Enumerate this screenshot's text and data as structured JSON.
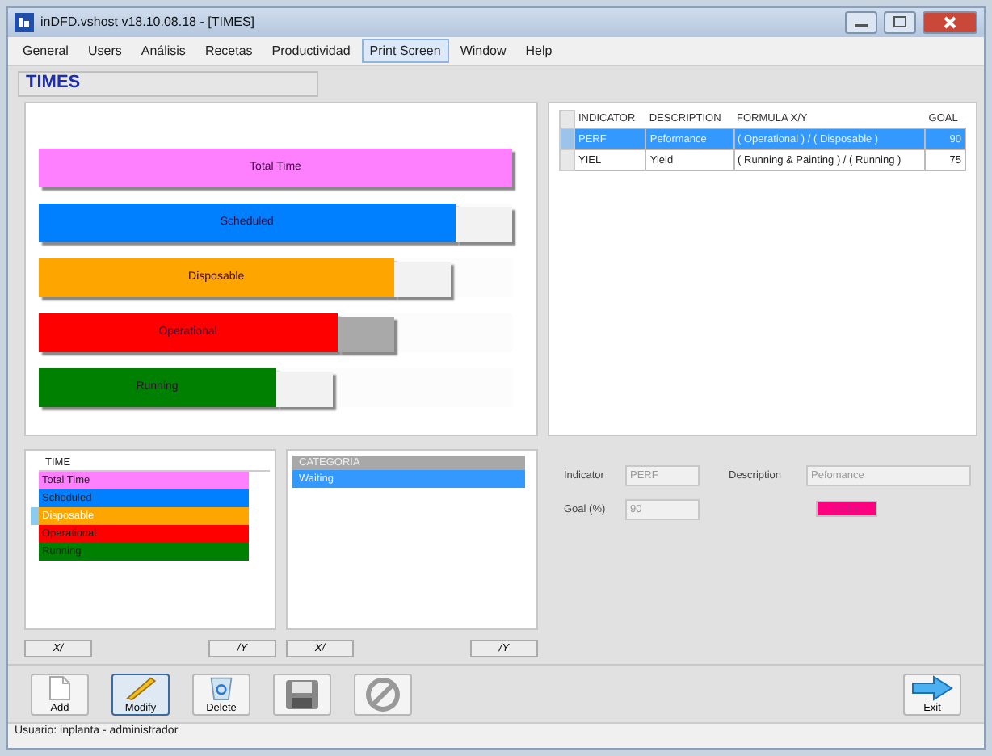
{
  "window": {
    "title": "inDFD.vshost v18.10.08.18 - [TIMES]"
  },
  "menu": [
    {
      "label": "General",
      "selected": false
    },
    {
      "label": "Users",
      "selected": false
    },
    {
      "label": "Análisis",
      "selected": false
    },
    {
      "label": "Recetas",
      "selected": false
    },
    {
      "label": "Productividad",
      "selected": false
    },
    {
      "label": "Print Screen",
      "selected": true
    },
    {
      "label": "Window",
      "selected": false
    },
    {
      "label": "Help",
      "selected": false
    }
  ],
  "header": {
    "title": "TIMES"
  },
  "bars": [
    {
      "label": "Total Time",
      "color": "#ff80ff",
      "level": 1.0
    },
    {
      "label": "Scheduled",
      "color": "#0080ff",
      "level": 0.88,
      "cap": {
        "color": "#f2f2f2"
      }
    },
    {
      "label": "Disposable",
      "color": "#ffa500",
      "level": 0.75,
      "cap": {
        "color": "#f2f2f2"
      }
    },
    {
      "label": "Operational",
      "color": "#ff0000",
      "level": 0.63,
      "cap": {
        "color": "#a9a9a9"
      }
    },
    {
      "label": "Running",
      "color": "#008000",
      "level": 0.5,
      "cap": {
        "color": "#f2f2f2"
      }
    }
  ],
  "indicators": {
    "columns": [
      "INDICATOR",
      "DESCRIPTION",
      "FORMULA X/Y",
      "GOAL"
    ],
    "rows": [
      {
        "cells": [
          "PERF",
          "Peformance",
          "( Operational ) / ( Disposable )",
          "90"
        ],
        "selected": true
      },
      {
        "cells": [
          "YIEL",
          "Yield",
          "( Running & Painting ) / ( Running )",
          "75"
        ],
        "selected": false
      }
    ]
  },
  "time_list": {
    "heading": "TIME",
    "items": [
      {
        "label": "Total Time",
        "color": "#ff80ff",
        "selected": false
      },
      {
        "label": "Scheduled",
        "color": "#0080ff",
        "selected": false
      },
      {
        "label": "Disposable",
        "color": "#ffa500",
        "selected": true
      },
      {
        "label": "Operational",
        "color": "#ff0000",
        "selected": false
      },
      {
        "label": "Running",
        "color": "#008000",
        "selected": false
      }
    ]
  },
  "category_list": {
    "heading": "CATEGORIA",
    "items": [
      {
        "label": "Waiting",
        "selected": true
      }
    ]
  },
  "left_buttons": [
    "X/",
    "/Y"
  ],
  "right_buttons": [
    "X/",
    "/Y"
  ],
  "form": {
    "indicator_label": "Indicator",
    "indicator": "PERF",
    "description_label": "Description",
    "description": "Pefomance",
    "goal_label": "Goal (%)",
    "goal": "90",
    "color_button": {
      "label": "Color",
      "color": "#ff0080"
    }
  },
  "toolbar": [
    {
      "kind": "add",
      "label": "Add",
      "selected": false
    },
    {
      "kind": "modify",
      "label": "Modify",
      "selected": true
    },
    {
      "kind": "delete",
      "label": "Delete",
      "selected": false
    },
    {
      "kind": "save",
      "selected": false
    },
    {
      "kind": "cancel",
      "selected": false
    },
    {
      "kind": "exit",
      "label": "Exit",
      "selected": false
    }
  ],
  "status_bar": "Usuario:  inplanta - administrador"
}
